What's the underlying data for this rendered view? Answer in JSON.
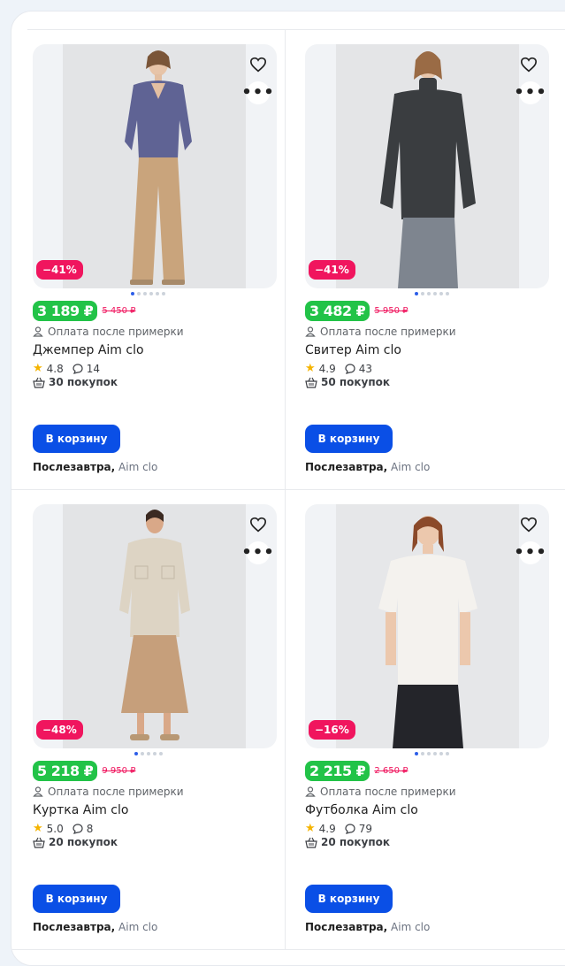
{
  "products": [
    {
      "discount": "−41%",
      "price": "3 189 ₽",
      "old_price": "5 450 ₽",
      "payment_note": "Оплата после примерки",
      "title": "Джемпер Aim clo",
      "rating": "4.8",
      "reviews": "14",
      "purchases": "30 покупок",
      "cart_label": "В корзину",
      "delivery": "Послезавтра,",
      "seller": "Aim clo",
      "dots": 6
    },
    {
      "discount": "−41%",
      "price": "3 482 ₽",
      "old_price": "5 950 ₽",
      "payment_note": "Оплата после примерки",
      "title": "Свитер Aim clo",
      "rating": "4.9",
      "reviews": "43",
      "purchases": "50 покупок",
      "cart_label": "В корзину",
      "delivery": "Послезавтра,",
      "seller": "Aim clo",
      "dots": 6
    },
    {
      "discount": "−48%",
      "price": "5 218 ₽",
      "old_price": "9 950 ₽",
      "payment_note": "Оплата после примерки",
      "title": "Куртка Aim clo",
      "rating": "5.0",
      "reviews": "8",
      "purchases": "20 покупок",
      "cart_label": "В корзину",
      "delivery": "Послезавтра,",
      "seller": "Aim clo",
      "dots": 5
    },
    {
      "discount": "−16%",
      "price": "2 215 ₽",
      "old_price": "2 650 ₽",
      "payment_note": "Оплата после примерки",
      "title": "Футболка Aim clo",
      "rating": "4.9",
      "reviews": "79",
      "purchases": "20 покупок",
      "cart_label": "В корзину",
      "delivery": "Послезавтра,",
      "seller": "Aim clo",
      "dots": 6
    }
  ],
  "icons": {
    "favorite": "heart-outline-icon",
    "more": "more-dots-icon",
    "payment": "person-icon",
    "rating": "star-icon",
    "reviews": "comment-icon",
    "purchases": "basket-icon"
  },
  "colors": {
    "price_bg": "#22c348",
    "discount_bg": "#f0155e",
    "cart_button": "#0a4fe6",
    "active_dot": "#2d5ee8",
    "star": "#f5b400"
  }
}
